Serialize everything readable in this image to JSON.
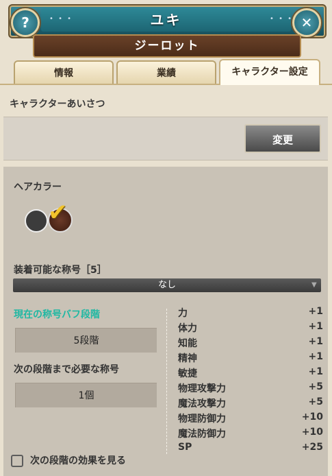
{
  "header": {
    "title": "ユキ",
    "subtitle": "ジーロット",
    "help_glyph": "?",
    "close_glyph": "✕",
    "dots": "• • •"
  },
  "tabs": [
    {
      "label": "情報"
    },
    {
      "label": "業績"
    },
    {
      "label": "キャラクター設定",
      "active": true
    }
  ],
  "greeting": {
    "label": "キャラクターあいさつ",
    "change_button": "変更"
  },
  "hair_color": {
    "label": "ヘアカラー",
    "swatches": [
      "#3c3c3c",
      "#5a2e1e"
    ],
    "selected_index": 1
  },
  "titles": {
    "label": "装着可能な称号［5］",
    "selected": "なし"
  },
  "buff": {
    "current_label": "現在の称号バフ段階",
    "current_value": "5段階",
    "next_label": "次の段階まで必要な称号",
    "next_value": "1個",
    "stats": [
      {
        "name": "力",
        "value": "+1"
      },
      {
        "name": "体力",
        "value": "+1"
      },
      {
        "name": "知能",
        "value": "+1"
      },
      {
        "name": "精神",
        "value": "+1"
      },
      {
        "name": "敏捷",
        "value": "+1"
      },
      {
        "name": "物理攻撃力",
        "value": "+5"
      },
      {
        "name": "魔法攻撃力",
        "value": "+5"
      },
      {
        "name": "物理防御力",
        "value": "+10"
      },
      {
        "name": "魔法防御力",
        "value": "+10"
      },
      {
        "name": "SP",
        "value": "+25"
      }
    ],
    "next_effect_label": "次の段階の効果を見る"
  },
  "colors": {
    "accent_teal": "#1fb8a3",
    "checkmark": "#f2c42c"
  }
}
